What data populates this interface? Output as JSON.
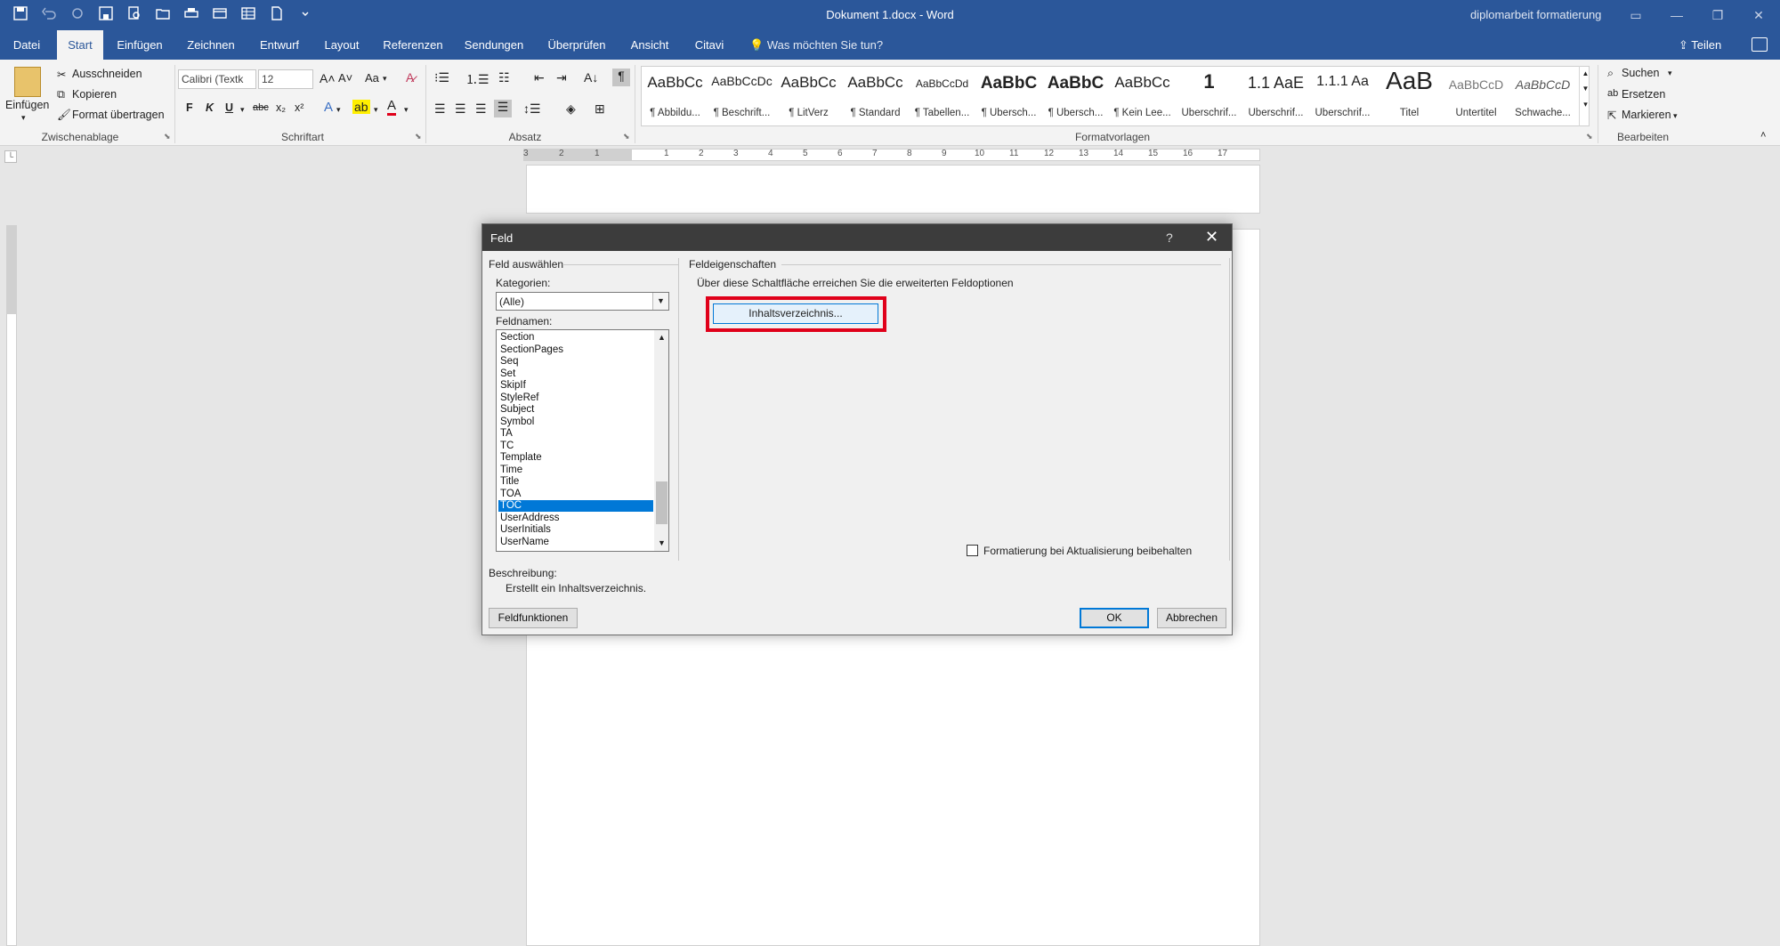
{
  "window": {
    "title": "Dokument 1.docx - Word",
    "user": "diplomarbeit formatierung"
  },
  "tabs": [
    "Datei",
    "Start",
    "Einfügen",
    "Zeichnen",
    "Entwurf",
    "Layout",
    "Referenzen",
    "Sendungen",
    "Überprüfen",
    "Ansicht",
    "Citavi"
  ],
  "active_tab": "Start",
  "tell_me": "Was möchten Sie tun?",
  "share_label": "Teilen",
  "ribbon": {
    "clipboard": {
      "paste": "Einfügen",
      "cut": "Ausschneiden",
      "copy": "Kopieren",
      "format_painter": "Format übertragen",
      "label": "Zwischenablage"
    },
    "font": {
      "font_name": "Calibri (Textk",
      "font_size": "12",
      "label": "Schriftart",
      "bold": "F",
      "italic": "K",
      "underline": "U",
      "strike": "abc",
      "sub": "x₂",
      "sup": "x²",
      "case": "Aa"
    },
    "paragraph": {
      "label": "Absatz"
    },
    "styles": {
      "label": "Formatvorlagen",
      "items": [
        {
          "preview": "AaBbCc",
          "name": "¶ Abbildu..."
        },
        {
          "preview": "AaBbCcDc",
          "name": "¶ Beschrift..."
        },
        {
          "preview": "AaBbCc",
          "name": "¶ LitVerz"
        },
        {
          "preview": "AaBbCc",
          "name": "¶ Standard"
        },
        {
          "preview": "AaBbCcDd",
          "name": "¶ Tabellen..."
        },
        {
          "preview": "AaBbC",
          "name": "¶ Übersch..."
        },
        {
          "preview": "AaBbC",
          "name": "¶ Übersch..."
        },
        {
          "preview": "AaBbCc",
          "name": "¶ Kein Lee..."
        },
        {
          "preview": "1",
          "name": "Überschrif..."
        },
        {
          "preview": "1.1 AaE",
          "name": "Überschrif..."
        },
        {
          "preview": "1.1.1 Aa",
          "name": "Überschrif..."
        },
        {
          "preview": "AaB",
          "name": "Titel"
        },
        {
          "preview": "AaBbCcD",
          "name": "Untertitel"
        },
        {
          "preview": "AaBbCcD",
          "name": "Schwache..."
        }
      ]
    },
    "editing": {
      "label": "Bearbeiten",
      "find": "Suchen",
      "replace": "Ersetzen",
      "select": "Markieren"
    }
  },
  "ruler_numbers": [
    "3",
    "2",
    "1",
    "1",
    "2",
    "3",
    "4",
    "5",
    "6",
    "7",
    "8",
    "9",
    "10",
    "11",
    "12",
    "13",
    "14",
    "15",
    "16",
    "17"
  ],
  "dialog": {
    "title": "Feld",
    "help": "?",
    "close": "✕",
    "select_field_section": "Feld auswählen",
    "categories_label": "Kategorien:",
    "category_value": "(Alle)",
    "field_names_label": "Feldnamen:",
    "field_names": [
      "Section",
      "SectionPages",
      "Seq",
      "Set",
      "SkipIf",
      "StyleRef",
      "Subject",
      "Symbol",
      "TA",
      "TC",
      "Template",
      "Time",
      "Title",
      "TOA",
      "TOC",
      "UserAddress",
      "UserInitials",
      "UserName"
    ],
    "selected_field": "TOC",
    "properties_section": "Feldeigenschaften",
    "properties_hint": "Über diese Schaltfläche erreichen Sie die erweiterten Feldoptionen",
    "toc_button": "Inhaltsverzeichnis...",
    "preserve_format": "Formatierung bei Aktualisierung beibehalten",
    "description_label": "Beschreibung:",
    "description": "Erstellt ein Inhaltsverzeichnis.",
    "field_codes_button": "Feldfunktionen",
    "ok": "OK",
    "cancel": "Abbrechen"
  },
  "colors": {
    "accent": "#2b579a",
    "highlight": "#e0001a",
    "selection": "#0078d7"
  }
}
